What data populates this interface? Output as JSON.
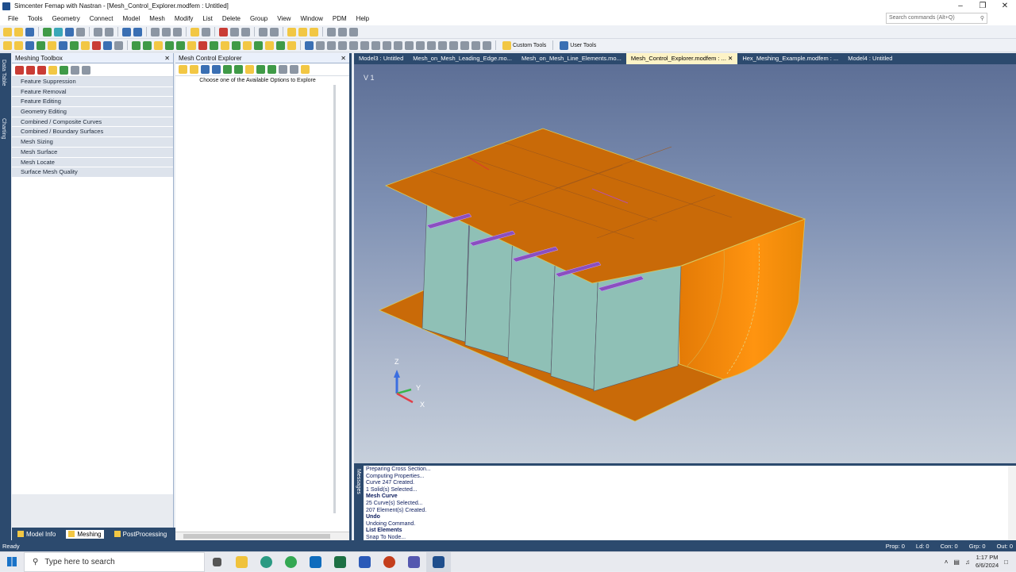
{
  "window": {
    "title": "Simcenter Femap with Nastran - [Mesh_Control_Explorer.modfem : Untitled]",
    "controls": [
      "–",
      "❐",
      "✕"
    ]
  },
  "menu": [
    "File",
    "Tools",
    "Geometry",
    "Connect",
    "Model",
    "Mesh",
    "Modify",
    "List",
    "Delete",
    "Group",
    "View",
    "Window",
    "PDM",
    "Help"
  ],
  "search": {
    "placeholder": "Search commands (Alt+Q)"
  },
  "toolbar": {
    "custom_tools": "Custom Tools",
    "user_tools": "User Tools"
  },
  "side_strip": {
    "data_table": "Data Table",
    "charting": "Charting"
  },
  "toolbox": {
    "title": "Meshing Toolbox",
    "items": [
      "Feature Suppression",
      "Feature Removal",
      "Feature Editing",
      "Geometry Editing",
      "Combined / Composite Curves",
      "Combined / Boundary Surfaces",
      "Mesh Sizing",
      "Mesh Surface",
      "Mesh Locate",
      "Surface Mesh Quality"
    ]
  },
  "left_tabs": [
    "Model Info",
    "Meshing",
    "PostProcessing"
  ],
  "explorer": {
    "title": "Mesh Control Explorer",
    "message": "Choose one of the Available Options to Explore"
  },
  "doc_tabs": [
    "Model3 : Untitled",
    "Mesh_on_Mesh_Leading_Edge.mo...",
    "Mesh_on_Mesh_Line_Elements.mo...",
    "Mesh_Control_Explorer.modfem : ...",
    "Hex_Meshing_Example.modfem : ...",
    "Model4 : Untitled"
  ],
  "viewport": {
    "view_label": "V 1",
    "axes": {
      "z": "Z",
      "y": "Y",
      "x": "X"
    }
  },
  "messages": {
    "strip_label": "Messages",
    "lines": [
      {
        "text": "Preparing Cross Section...",
        "bold": false
      },
      {
        "text": "Computing Properties...",
        "bold": false
      },
      {
        "text": "Curve 247 Created.",
        "bold": false
      },
      {
        "text": "1 Solid(s) Selected...",
        "bold": false
      },
      {
        "text": "Mesh Curve",
        "bold": true
      },
      {
        "text": "25 Curve(s) Selected...",
        "bold": false
      },
      {
        "text": "207 Element(s) Created.",
        "bold": false
      },
      {
        "text": "Undo",
        "bold": true
      },
      {
        "text": "Undoing  Command.",
        "bold": false
      },
      {
        "text": "List Elements",
        "bold": true
      },
      {
        "text": "Snap To Node...",
        "bold": false
      }
    ]
  },
  "status": {
    "ready": "Ready",
    "prop": "Prop: 0",
    "ld": "Ld: 0",
    "con": "Con: 0",
    "grp": "Grp: 0",
    "out": "Out: 0"
  },
  "taskbar": {
    "search_placeholder": "Type here to search",
    "time": "1:17 PM",
    "date": "6/6/2024"
  },
  "colors": {
    "panel_dark": "#2c4a6e",
    "shell_orange": "#c96a08",
    "bulkhead_teal": "#8fc0b6",
    "stiffener_purple": "#8a4fbf"
  }
}
